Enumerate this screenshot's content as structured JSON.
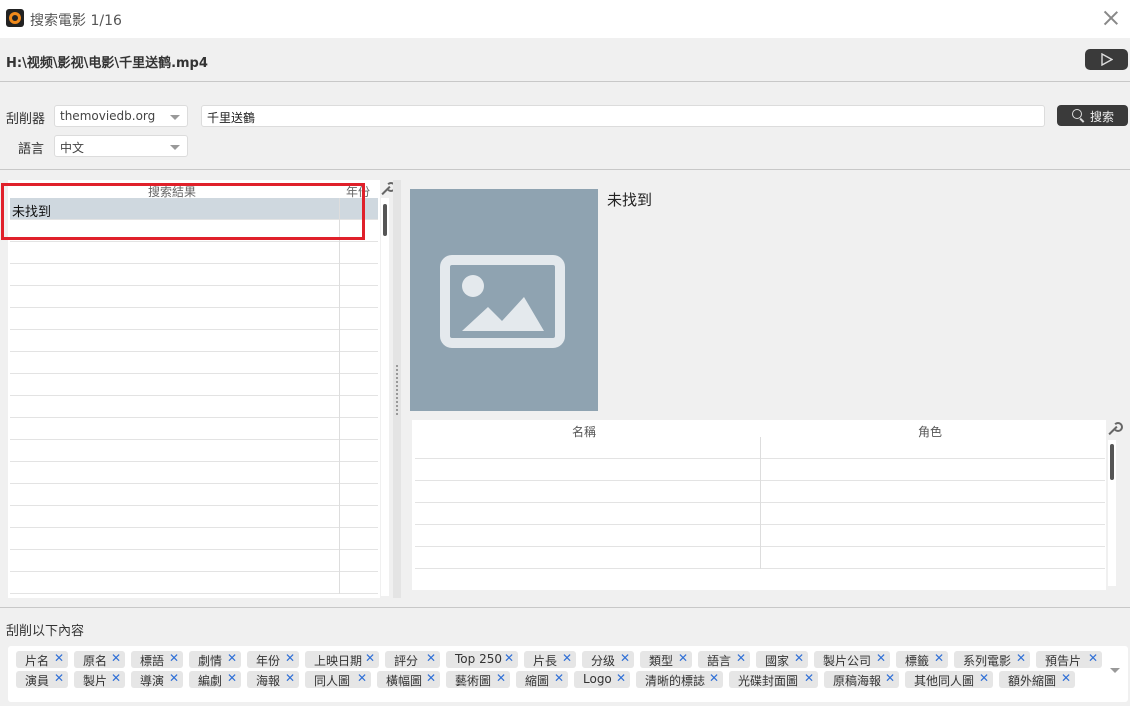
{
  "window": {
    "title": "搜索電影 1/16"
  },
  "file_path": "H:\\视频\\影视\\电影\\千里送鹤.mp4",
  "scraper": {
    "label": "刮削器",
    "value": "themoviedb.org"
  },
  "language": {
    "label": "語言",
    "value": "中文"
  },
  "search": {
    "query": "千里送鶴",
    "button_label": "搜索"
  },
  "results": {
    "header_title": "搜索結果",
    "header_year": "年份",
    "rows": [
      {
        "title": "未找到",
        "year": ""
      }
    ]
  },
  "detail": {
    "title": "未找到"
  },
  "cast": {
    "header_name": "名稱",
    "header_role": "角色"
  },
  "scrape_section": {
    "label": "刮削以下內容",
    "tags_row1": [
      "片名",
      "原名",
      "標語",
      "劇情",
      "年份",
      "上映日期",
      "評分",
      "Top 250",
      "片長",
      "分级",
      "類型",
      "語言",
      "國家",
      "製片公司",
      "標籤",
      "系列電影",
      "預告片"
    ],
    "tags_row2": [
      "演員",
      "製片",
      "導演",
      "編劇",
      "海報",
      "同人圖",
      "橫幅圖",
      "藝術圖",
      "縮圖",
      "Logo",
      "清晰的標誌",
      "光碟封面圖",
      "原稿海報",
      "其他同人圖",
      "額外縮圖"
    ]
  },
  "colors": {
    "highlight_box": "#e0202a",
    "tag_remove": "#2f6fd6",
    "poster_bg": "#8fa3b1"
  },
  "icons": [
    "app-icon",
    "close-icon",
    "play-icon",
    "search-icon",
    "wrench-icon",
    "image-placeholder-icon",
    "remove-x-icon"
  ]
}
